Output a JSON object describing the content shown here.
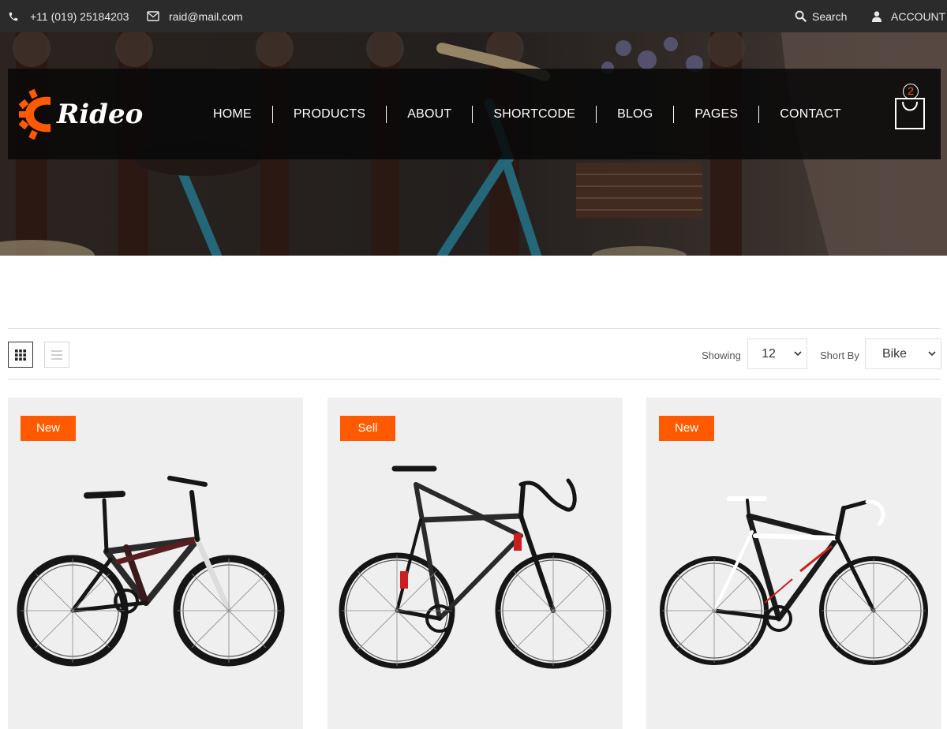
{
  "topbar": {
    "phone": "+11 (019) 25184203",
    "email": "raid@mail.com",
    "search_label": "Search",
    "account_label": "ACCOUNT"
  },
  "brand": {
    "name": "Rideo",
    "accent": "#ff5a00"
  },
  "nav": {
    "items": [
      "HOME",
      "PRODUCTS",
      "ABOUT",
      "SHORTCODE",
      "BLOG",
      "PAGES",
      "CONTACT"
    ]
  },
  "cart": {
    "count": "2"
  },
  "toolbar": {
    "showing_label": "Showing",
    "showing_value": "12",
    "sort_label": "Short By",
    "sort_value": "Bike"
  },
  "products": [
    {
      "badge": "New",
      "bike": "mountain"
    },
    {
      "badge": "Sell",
      "bike": "gravel"
    },
    {
      "badge": "New",
      "bike": "road"
    }
  ],
  "colors": {
    "topbar_bg": "#2b2b2b",
    "accent": "#ff5a00",
    "card_bg": "#efefef"
  }
}
